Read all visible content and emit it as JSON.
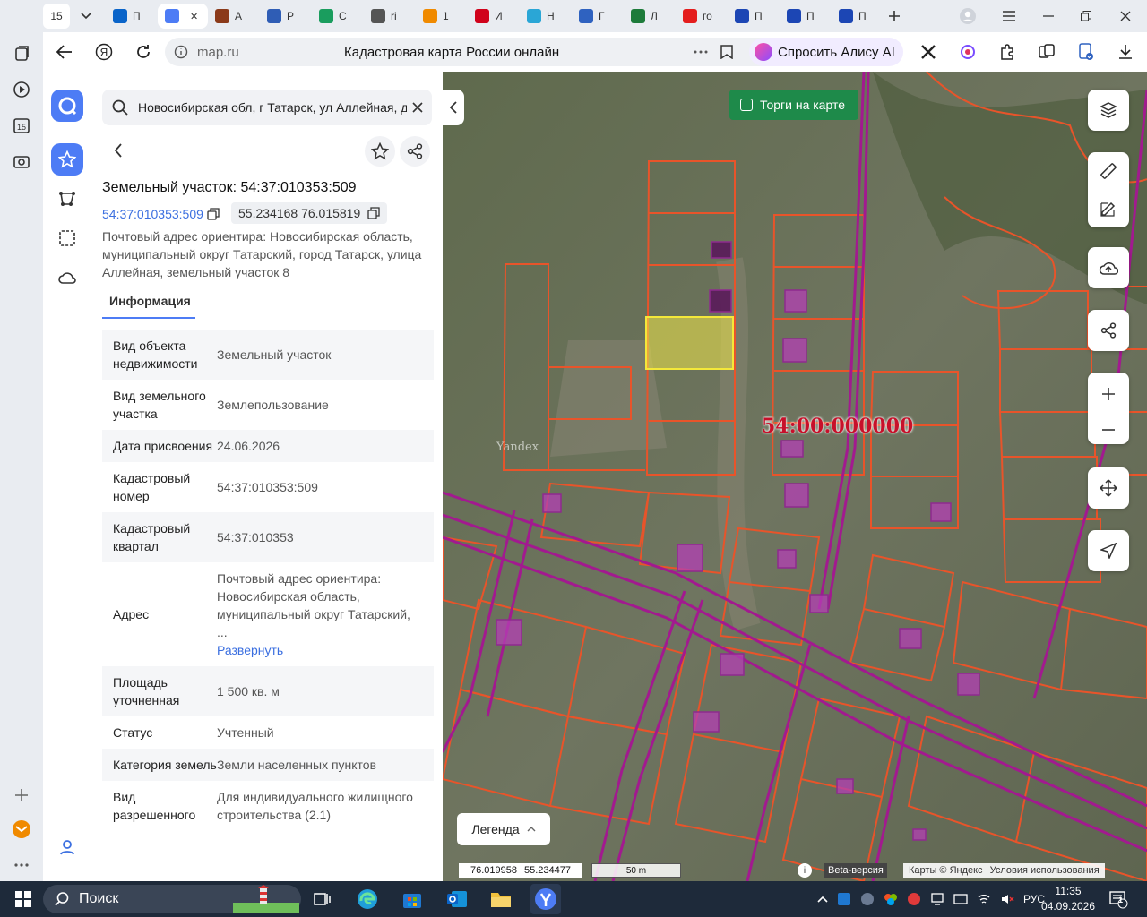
{
  "browser": {
    "tab_counter": "15",
    "tabs": [
      {
        "short": "П",
        "icon": "outlook-icon",
        "color": "#0a64c9"
      },
      {
        "short": "",
        "icon": "alice-icon",
        "color": "#4d7cf5"
      },
      {
        "short": "А",
        "icon": "cube-icon",
        "color": "#8b3a1a"
      },
      {
        "short": "Р",
        "icon": "stripe-icon",
        "color": "#2f5db5"
      },
      {
        "short": "С",
        "icon": "gmail-icon",
        "color": "#1a9d5e"
      },
      {
        "short": "ri",
        "icon": "document-icon",
        "color": "#555555"
      },
      {
        "short": "1",
        "icon": "mail-icon",
        "color": "#f08a00"
      },
      {
        "short": "И",
        "icon": "rtc-icon",
        "color": "#d0021b"
      },
      {
        "short": "Н",
        "icon": "chat-icon",
        "color": "#2aa6d6"
      },
      {
        "short": "Г",
        "icon": "emblem-icon",
        "color": "#2f62c0"
      },
      {
        "short": "Л",
        "icon": "gov-icon",
        "color": "#1d7b3a"
      },
      {
        "short": "го",
        "icon": "yandex-icon",
        "color": "#e41d1d"
      },
      {
        "short": "П",
        "icon": "flag-icon",
        "color": "#1c46b4"
      },
      {
        "short": "П",
        "icon": "flag-icon",
        "color": "#1c46b4"
      },
      {
        "short": "П",
        "icon": "flag-icon",
        "color": "#1c46b4"
      }
    ],
    "omnibox": {
      "domain": "map.ru",
      "title": "Кадастровая карта России онлайн"
    },
    "alice_label": "Спросить Алису AI"
  },
  "panel": {
    "search_value": "Новосибирская обл, г Татарск, ул Аллейная, д",
    "title": "Земельный участок: 54:37:010353:509",
    "cadastral_link": "54:37:010353:509",
    "coordinates": "55.234168 76.015819",
    "address_line": "Почтовый адрес ориентира: Новосибирская область, муниципальный округ Татарский, город Татарск, улица Аллейная, земельный участок 8",
    "tab_info": "Информация",
    "rows": [
      {
        "label": "Вид объекта недвижимости",
        "value": "Земельный участок"
      },
      {
        "label": "Вид земельного участка",
        "value": "Землепользование"
      },
      {
        "label": "Дата присвоения",
        "value": "24.06.2026"
      },
      {
        "label": "Кадастровый номер",
        "value": "54:37:010353:509"
      },
      {
        "label": "Кадастровый квартал",
        "value": "54:37:010353"
      },
      {
        "label": "Адрес",
        "value": "Почтовый адрес ориентира: Новосибирская область, муниципальный округ Татарский, ...",
        "expand": "Развернуть"
      },
      {
        "label": "Площадь уточненная",
        "value": "1 500 кв. м"
      },
      {
        "label": "Статус",
        "value": "Учтенный"
      },
      {
        "label": "Категория земель",
        "value": "Земли населенных пунктов"
      },
      {
        "label": "Вид разрешенного",
        "value": "Для индивидуального жилищного строительства (2.1)"
      }
    ]
  },
  "map": {
    "auction_label": "Торги на карте",
    "cadastral_label": "54:00:000000",
    "watermark": "Yandex",
    "legend_label": "Легенда",
    "cursor_lon": "76.019958",
    "cursor_lat": "55.234477",
    "scale_label": "50 m",
    "beta_label": "Beta-версия",
    "copyright": "Карты © Яндекс",
    "terms": "Условия использования",
    "colors": {
      "parcel_border": "#e8542a",
      "building": "#b43fb4",
      "selected": "#f0e84a",
      "road": "#a21a8f"
    }
  },
  "taskbar": {
    "search_placeholder": "Поиск",
    "language": "РУС",
    "time": "11:35",
    "date": "04.09.2026",
    "notifications": "1"
  }
}
